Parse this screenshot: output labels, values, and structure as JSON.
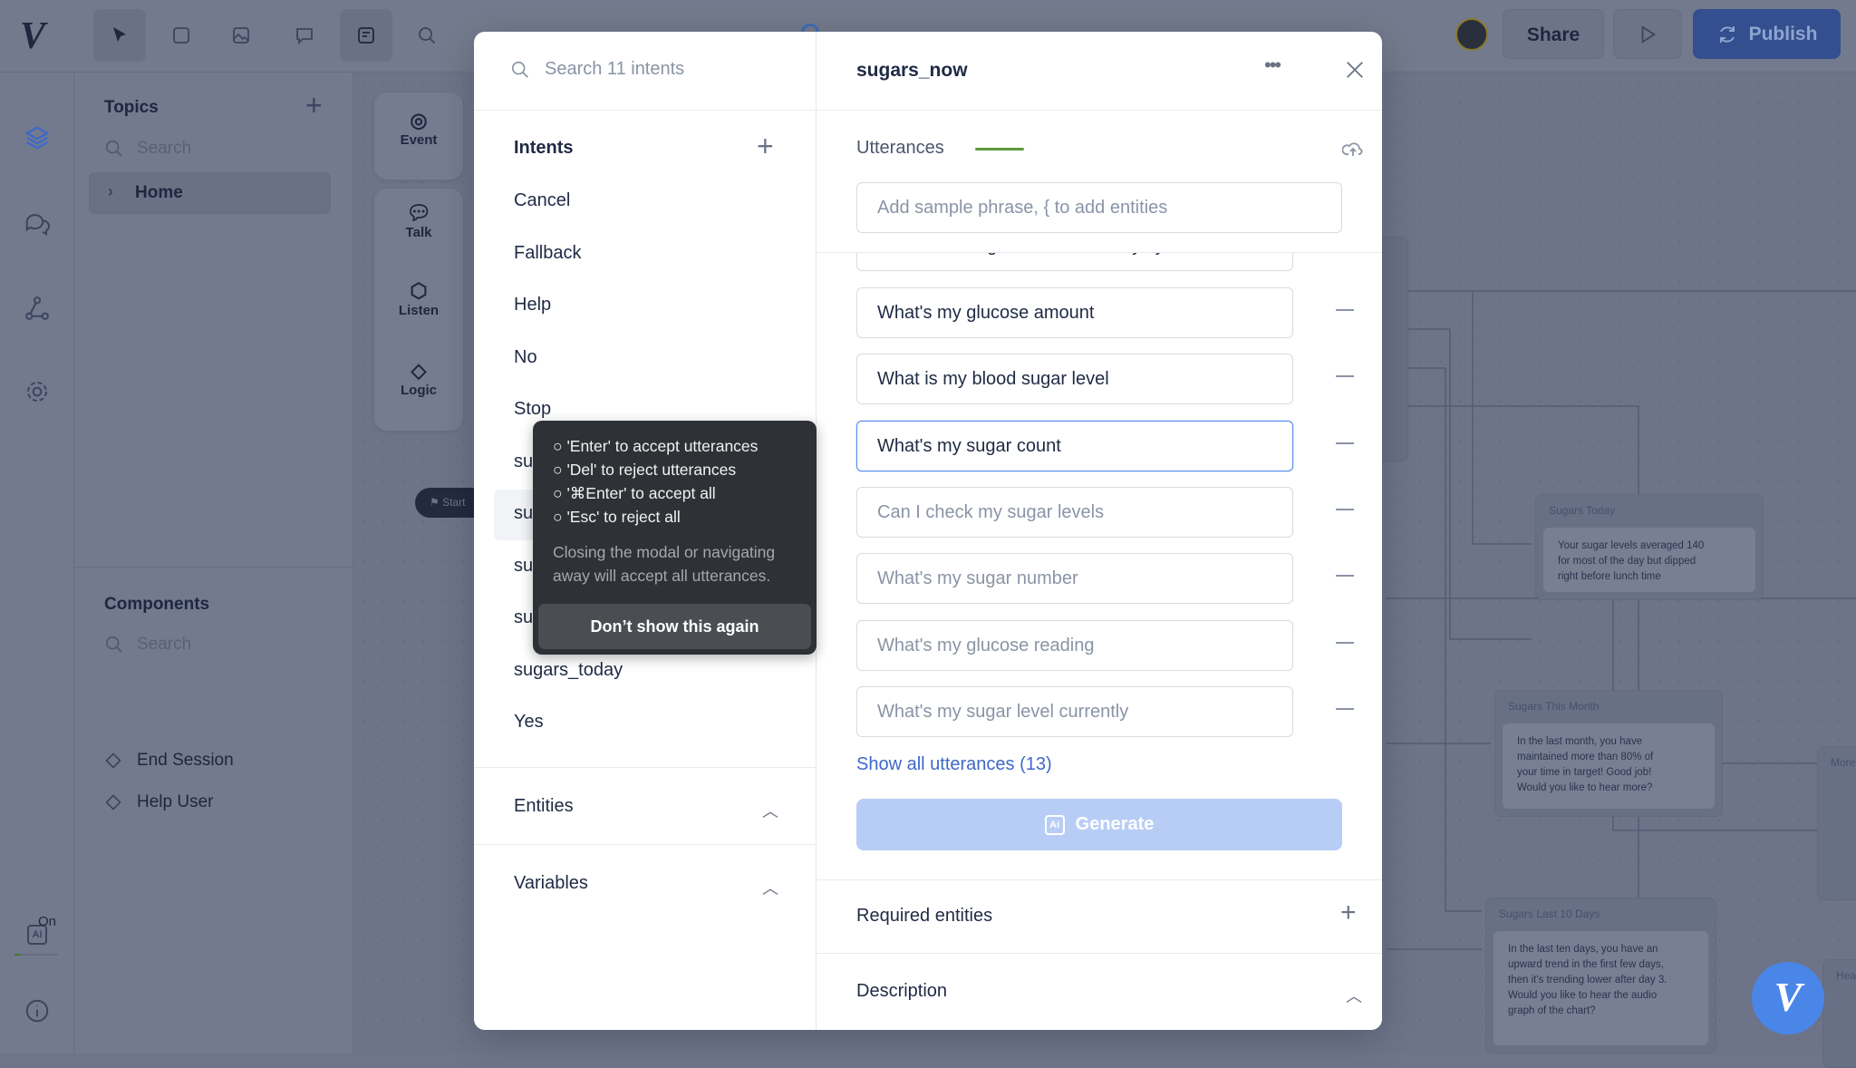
{
  "topbar": {
    "tools": [
      "pointer-icon",
      "note-icon",
      "image-icon",
      "comment-icon",
      "intent-icon",
      "search-icon"
    ],
    "share_label": "Share",
    "publish_label": "Publish"
  },
  "rail": {
    "ai_badge": "On"
  },
  "topics": {
    "title": "Topics",
    "search_placeholder": "Search",
    "items": [
      {
        "label": "Home"
      }
    ]
  },
  "components": {
    "title": "Components",
    "search_placeholder": "Search",
    "items": [
      {
        "label": "End Session"
      },
      {
        "label": "Help User"
      }
    ]
  },
  "steps": [
    {
      "label": "Event"
    },
    {
      "label": "Talk"
    },
    {
      "label": "Listen"
    },
    {
      "label": "Logic"
    }
  ],
  "canvas": {
    "start_label": "Start",
    "nodes": [
      {
        "title": "Sugars Today",
        "text": "Your sugar levels averaged 140 for most of the day but dipped right before lunch time"
      },
      {
        "title": "Sugars This Month",
        "text": "In the last month, you have maintained more than 80% of your time in target! Good job! Would you like to hear more?"
      },
      {
        "title": "Sugars Last 10 Days",
        "text": "In the last ten days, you have an upward trend in the first few days, then it's trending lower after day 3. Would you like to hear the audio graph of the chart?"
      },
      {
        "title": "More"
      },
      {
        "title": "Hea"
      }
    ]
  },
  "modal": {
    "search_placeholder": "Search 11 intents",
    "intents_title": "Intents",
    "intents": [
      "Cancel",
      "Fallback",
      "Help",
      "No",
      "Stop",
      "su",
      "su",
      "su",
      "su",
      "sugars_today",
      "Yes"
    ],
    "selected_index": 6,
    "entities_title": "Entities",
    "variables_title": "Variables",
    "intent_name": "sugars_now",
    "utterances_title": "Utterances",
    "utterance_placeholder": "Add sample phrase, { to add entities",
    "partial_utterance": "How much sugar do I have in my system",
    "utterances": [
      {
        "text": "What's my glucose amount",
        "state": "saved"
      },
      {
        "text": "What is my blood sugar level",
        "state": "saved"
      },
      {
        "text": "What's my sugar count",
        "state": "active"
      },
      {
        "text": "Can I check my sugar levels",
        "state": "pending"
      },
      {
        "text": "What's my sugar number",
        "state": "pending"
      },
      {
        "text": "What's my glucose reading",
        "state": "pending"
      },
      {
        "text": "What's my sugar level currently",
        "state": "pending"
      }
    ],
    "show_all_label": "Show all utterances (13)",
    "generate_label": "Generate",
    "required_entities_title": "Required entities",
    "description_title": "Description"
  },
  "tooltip": {
    "lines": [
      "'Enter' to accept utterances",
      "'Del' to reject utterances",
      "'⌘Enter' to accept all",
      "'Esc' to reject all"
    ],
    "note": "Closing the modal or navigating away will accept all utterances.",
    "button_label": "Don’t show this again"
  },
  "colors": {
    "accent": "#3d68c9",
    "generate": "#b8cdf6",
    "utterance_bar": "#5c9b3c",
    "tooltip_bg": "#2e3236"
  }
}
